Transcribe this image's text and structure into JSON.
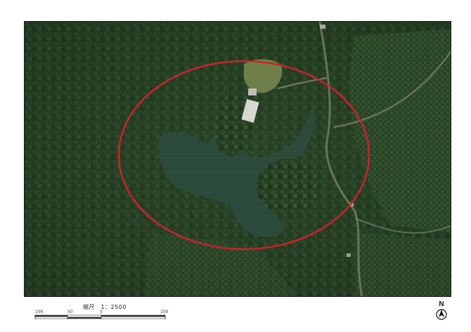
{
  "map": {
    "type": "aerial-photograph",
    "highlight_color": "#d0202a",
    "features": [
      "forest",
      "pond",
      "building",
      "road",
      "clearing"
    ]
  },
  "scale": {
    "title": "縮尺　1：2500",
    "ticks": [
      "100",
      "50",
      "0",
      "100"
    ]
  },
  "north_arrow": {
    "label": "N",
    "icon": "north-arrow-icon"
  }
}
